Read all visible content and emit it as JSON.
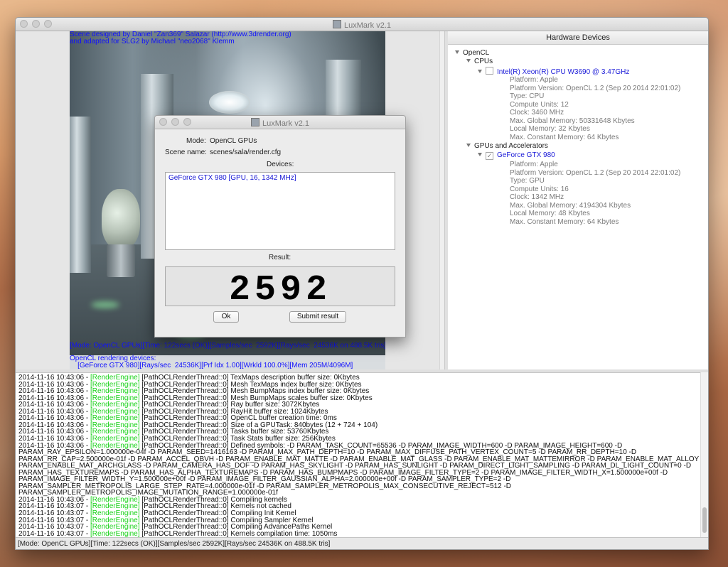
{
  "window": {
    "title": "LuxMark v2.1"
  },
  "render_view": {
    "credit_line_1": "Scene designed by Daniel \"Zan369\" Salazar (http://www.3drender.org)",
    "credit_line_2": "and adapted for SLG2 by Michael \"neo2068\" Klemm",
    "stats_line": "[Mode: OpenCL GPUs][Time: 122secs (OK)][Samples/sec  2592K][Rays/sec  24536K on 488.5K tris]",
    "devices_heading": "OpenCL rendering devices:",
    "device_line": "    [GeForce GTX 980][Rays/sec  24536K][Prf Idx 1.00][Wrkld 100.0%][Mem 205M/4096M]"
  },
  "hardware": {
    "header": "Hardware Devices",
    "root": "OpenCL",
    "cpus_group": "CPUs",
    "cpu": {
      "name": "Intel(R) Xeon(R) CPU         W3690  @ 3.47GHz",
      "props": [
        "Platform: Apple",
        "Platform Version: OpenCL 1.2 (Sep 20 2014 22:01:02)",
        "Type: CPU",
        "Compute Units: 12",
        "Clock: 3460 MHz",
        "Max. Global Memory: 50331648 Kbytes",
        "Local Memory: 32 Kbytes",
        "Max. Constant Memory: 64 Kbytes"
      ]
    },
    "gpus_group": "GPUs and Accelerators",
    "gpu": {
      "name": "GeForce GTX 980",
      "checked": "✓",
      "props": [
        "Platform: Apple",
        "Platform Version: OpenCL 1.2 (Sep 20 2014 22:01:02)",
        "Type: GPU",
        "Compute Units: 16",
        "Clock: 1342 MHz",
        "Max. Global Memory: 4194304 Kbytes",
        "Local Memory: 48 Kbytes",
        "Max. Constant Memory: 64 Kbytes"
      ]
    }
  },
  "dialog": {
    "title": "LuxMark v2.1",
    "mode_label": "Mode:",
    "mode_value": "OpenCL GPUs",
    "scene_label": "Scene name:",
    "scene_value": "scenes/sala/render.cfg",
    "devices_label": "Devices:",
    "devices_item": "GeForce GTX 980 [GPU, 16, 1342 MHz]",
    "result_label": "Result:",
    "result_value": "2592",
    "ok_label": "Ok",
    "submit_label": "Submit result"
  },
  "log": [
    {
      "ts": "2014-11-16 10:43:06 - ",
      "tag": "[RenderEngine]",
      "msg": " [PathOCLRenderThread::0] TexMaps description buffer size: 0Kbytes"
    },
    {
      "ts": "2014-11-16 10:43:06 - ",
      "tag": "[RenderEngine]",
      "msg": " [PathOCLRenderThread::0] Mesh TexMaps index buffer size: 0Kbytes"
    },
    {
      "ts": "2014-11-16 10:43:06 - ",
      "tag": "[RenderEngine]",
      "msg": " [PathOCLRenderThread::0] Mesh BumpMaps index buffer size: 0Kbytes"
    },
    {
      "ts": "2014-11-16 10:43:06 - ",
      "tag": "[RenderEngine]",
      "msg": " [PathOCLRenderThread::0] Mesh BumpMaps scales buffer size: 0Kbytes"
    },
    {
      "ts": "2014-11-16 10:43:06 - ",
      "tag": "[RenderEngine]",
      "msg": " [PathOCLRenderThread::0] Ray buffer size: 3072Kbytes"
    },
    {
      "ts": "2014-11-16 10:43:06 - ",
      "tag": "[RenderEngine]",
      "msg": " [PathOCLRenderThread::0] RayHit buffer size: 1024Kbytes"
    },
    {
      "ts": "2014-11-16 10:43:06 - ",
      "tag": "[RenderEngine]",
      "msg": " [PathOCLRenderThread::0] OpenCL buffer creation time: 0ms"
    },
    {
      "ts": "2014-11-16 10:43:06 - ",
      "tag": "[RenderEngine]",
      "msg": " [PathOCLRenderThread::0] Size of a GPUTask: 840bytes (12 + 724 + 104)"
    },
    {
      "ts": "2014-11-16 10:43:06 - ",
      "tag": "[RenderEngine]",
      "msg": " [PathOCLRenderThread::0] Tasks buffer size: 53760Kbytes"
    },
    {
      "ts": "2014-11-16 10:43:06 - ",
      "tag": "[RenderEngine]",
      "msg": " [PathOCLRenderThread::0] Task Stats buffer size: 256Kbytes"
    },
    {
      "ts": "2014-11-16 10:43:06 - ",
      "tag": "[RenderEngine]",
      "msg": " [PathOCLRenderThread::0] Defined symbols: -D PARAM_TASK_COUNT=65536 -D PARAM_IMAGE_WIDTH=600 -D PARAM_IMAGE_HEIGHT=600 -D"
    },
    {
      "ts": "",
      "tag": "",
      "msg": "PARAM_RAY_EPSILON=1.000000e-04f -D PARAM_SEED=1416163 -D PARAM_MAX_PATH_DEPTH=10 -D PARAM_MAX_DIFFUSE_PATH_VERTEX_COUNT=5 -D PARAM_RR_DEPTH=10 -D"
    },
    {
      "ts": "",
      "tag": "",
      "msg": "PARAM_RR_CAP=2.500000e-01f -D PARAM_ACCEL_QBVH -D PARAM_ENABLE_MAT_MATTE -D PARAM_ENABLE_MAT_GLASS -D PARAM_ENABLE_MAT_MATTEMIRROR -D PARAM_ENABLE_MAT_ALLOY -D"
    },
    {
      "ts": "",
      "tag": "",
      "msg": "PARAM_ENABLE_MAT_ARCHGLASS -D PARAM_CAMERA_HAS_DOF -D PARAM_HAS_SKYLIGHT -D PARAM_HAS_SUNLIGHT -D PARAM_DIRECT_LIGHT_SAMPLING -D PARAM_DL_LIGHT_COUNT=0 -D"
    },
    {
      "ts": "",
      "tag": "",
      "msg": "PARAM_HAS_TEXTUREMAPS -D PARAM_HAS_ALPHA_TEXTUREMAPS -D PARAM_HAS_BUMPMAPS -D PARAM_IMAGE_FILTER_TYPE=2 -D PARAM_IMAGE_FILTER_WIDTH_X=1.500000e+00f -D"
    },
    {
      "ts": "",
      "tag": "",
      "msg": "PARAM_IMAGE_FILTER_WIDTH_Y=1.500000e+00f -D PARAM_IMAGE_FILTER_GAUSSIAN_ALPHA=2.000000e+00f -D PARAM_SAMPLER_TYPE=2 -D"
    },
    {
      "ts": "",
      "tag": "",
      "msg": "PARAM_SAMPLER_METROPOLIS_LARGE_STEP_RATE=4.000000e-01f -D PARAM_SAMPLER_METROPOLIS_MAX_CONSECUTIVE_REJECT=512 -D"
    },
    {
      "ts": "",
      "tag": "",
      "msg": "PARAM_SAMPLER_METROPOLIS_IMAGE_MUTATION_RANGE=1.000000e-01f"
    },
    {
      "ts": "2014-11-16 10:43:06 - ",
      "tag": "[RenderEngine]",
      "msg": " [PathOCLRenderThread::0] Compiling kernels"
    },
    {
      "ts": "2014-11-16 10:43:07 - ",
      "tag": "[RenderEngine]",
      "msg": " [PathOCLRenderThread::0] Kernels not cached"
    },
    {
      "ts": "2014-11-16 10:43:07 - ",
      "tag": "[RenderEngine]",
      "msg": " [PathOCLRenderThread::0] Compiling Init Kernel"
    },
    {
      "ts": "2014-11-16 10:43:07 - ",
      "tag": "[RenderEngine]",
      "msg": " [PathOCLRenderThread::0] Compiling Sampler Kernel"
    },
    {
      "ts": "2014-11-16 10:43:07 - ",
      "tag": "[RenderEngine]",
      "msg": " [PathOCLRenderThread::0] Compiling AdvancePaths Kernel"
    },
    {
      "ts": "2014-11-16 10:43:07 - ",
      "tag": "[RenderEngine]",
      "msg": " [PathOCLRenderThread::0] Kernels compilation time: 1050ms"
    }
  ],
  "statusbar": "[Mode: OpenCL GPUs][Time: 122secs (OK)][Samples/sec  2592K][Rays/sec  24536K on 488.5K tris]"
}
